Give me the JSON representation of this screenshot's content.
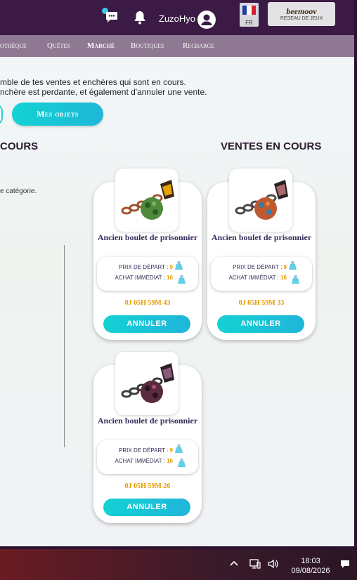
{
  "header": {
    "username": "ZuzoHyo",
    "language_code": "FR",
    "partner_logo_text": "beemoov",
    "partner_tagline": "RESEAU DE JEUX"
  },
  "nav": {
    "items": [
      "othèque",
      "Quêtes",
      "Marché",
      "Boutiques",
      "Recharge"
    ],
    "active": "Marché"
  },
  "intro": {
    "line1": "mble de tes ventes et enchères qui sont en cours.",
    "line2": "nchère est perdante, et également d'annuler une vente."
  },
  "buttons": {
    "my_items": "Mes objets"
  },
  "columns": {
    "left_title": "COURS",
    "right_title": "VENTES EN COURS",
    "left_category_text": "e catégorie."
  },
  "sales": [
    {
      "name": "Ancien boulet de prisonnier",
      "start_price_label": "PRIX DE DÉPART :",
      "start_price": "9",
      "buyout_label": "ACHAT IMMÉDIAT :",
      "buyout_price": "16",
      "time_left": "0J 05H 59M 43",
      "cancel_label": "ANNULER",
      "ball_color": "#4f8a3c"
    },
    {
      "name": "Ancien boulet de prisonnier",
      "start_price_label": "PRIX DE DÉPART :",
      "start_price": "9",
      "buyout_label": "ACHAT IMMÉDIAT :",
      "buyout_price": "16",
      "time_left": "0J 05H 59M 33",
      "cancel_label": "ANNULER",
      "ball_color": "#c0592f"
    },
    {
      "name": "Ancien boulet de prisonnier",
      "start_price_label": "PRIX DE DÉPART :",
      "start_price": "9",
      "buyout_label": "ACHAT IMMÉDIAT :",
      "buyout_price": "16",
      "time_left": "0J 05H 59M 26",
      "cancel_label": "ANNULER",
      "ball_color": "#5a2a3e"
    }
  ],
  "taskbar": {
    "time": "18:03",
    "date": "09/08/2026"
  },
  "colors": {
    "accent": "#1fd0d6",
    "price": "#e69a00",
    "header": "#3b1a45",
    "nav": "#8f7892"
  }
}
